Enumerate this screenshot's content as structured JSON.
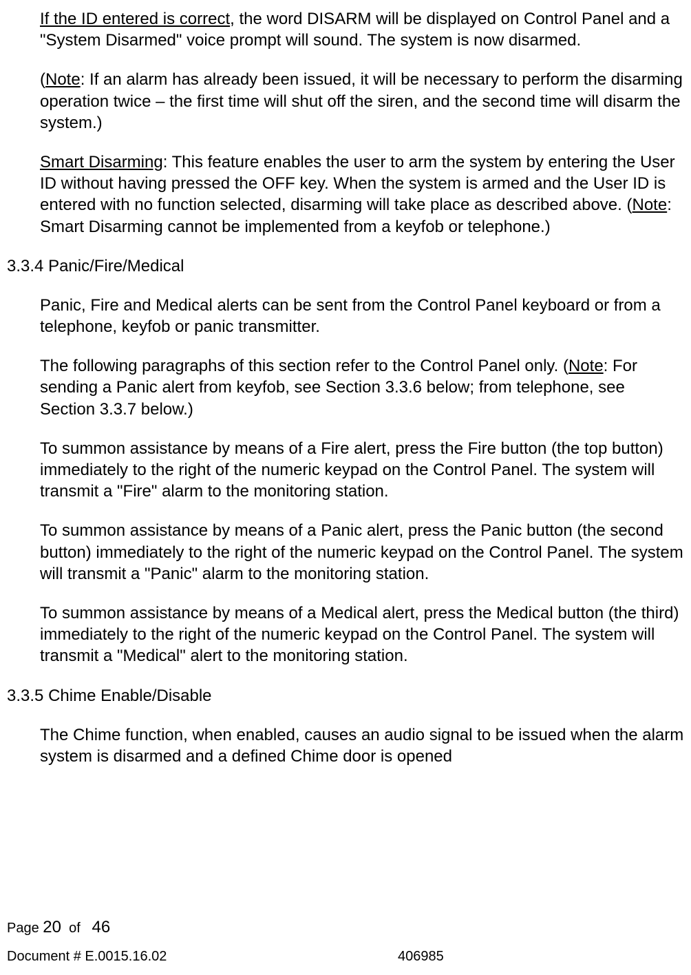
{
  "paragraphs": {
    "p1": {
      "underline": "If the ID entered is correct",
      "text": ", the word DISARM will be displayed on Control Panel and a \"System Disarmed\" voice prompt will sound. The system is now disarmed."
    },
    "p2": {
      "prefix": "(",
      "underline": "Note",
      "text": ": If an alarm has already been issued, it will be necessary to perform the disarming operation twice – the first time will shut off the siren, and the second time will disarm the system.)"
    },
    "p3": {
      "underline1": "Smart Disarming",
      "text1": ": This feature enables the user to arm the system by entering the User ID without having pressed the OFF key. When the system is armed and the User ID is entered with no function selected, disarming will take place as described above. (",
      "underline2": "Note",
      "text2": ": Smart Disarming cannot be implemented from a keyfob or telephone.)"
    },
    "heading1": {
      "number": "3.3.4",
      "title": "Panic/Fire/Medical"
    },
    "p4": {
      "text": "Panic, Fire and Medical alerts can be sent from the Control Panel keyboard or from a telephone, keyfob or panic transmitter."
    },
    "p5": {
      "text1": "The following paragraphs of this section refer to the Control Panel only. (",
      "underline": "Note",
      "text2": ": For sending a Panic alert from keyfob, see Section 3.3.6 below; from telephone, see Section 3.3.7 below.)"
    },
    "p6": {
      "text": "To summon assistance by means of a Fire alert, press the Fire button (the top button) immediately to the right of the numeric keypad on the Control Panel. The system will transmit a \"Fire\" alarm to the monitoring station."
    },
    "p7": {
      "text": "To summon assistance by means of a Panic alert, press the Panic button (the second button) immediately to the right of the numeric keypad on the Control Panel. The system will transmit a \"Panic\" alarm to the monitoring station."
    },
    "p8": {
      "text": "To summon assistance by means of a Medical alert, press the Medical button (the third) immediately to the right of the numeric keypad on the Control Panel. The system will transmit a \"Medical\" alert to the monitoring station."
    },
    "heading2": {
      "number": "3.3.5",
      "title": "Chime Enable/Disable"
    },
    "p9": {
      "text": "The Chime function, when enabled, causes an audio signal to be issued when the alarm system is disarmed and a defined Chime door is opened"
    }
  },
  "footer": {
    "page_label": "Page",
    "page_current": "20",
    "page_of": "of",
    "page_total": "46",
    "document_label": "Document # E.0015.16.02",
    "document_code": "406985"
  }
}
